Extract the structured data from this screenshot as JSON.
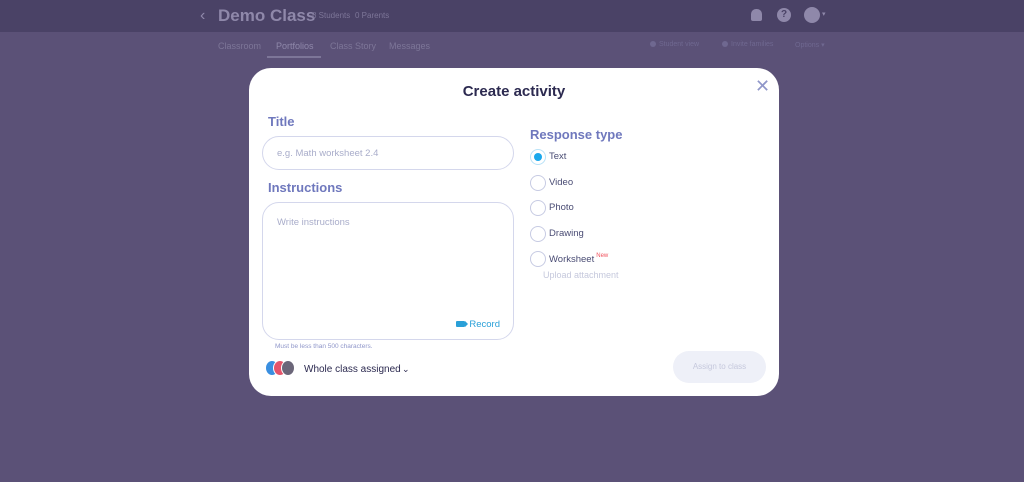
{
  "app": {
    "back_glyph": "‹",
    "class_name": "Demo Class",
    "student_count": "8 Students",
    "parent_count": "0 Parents",
    "help_glyph": "?",
    "caret_glyph": "▾"
  },
  "tabs": [
    {
      "label": "Classroom"
    },
    {
      "label": "Portfolios"
    },
    {
      "label": "Class Story"
    },
    {
      "label": "Messages"
    }
  ],
  "toolbar_right": {
    "student_view": "Student view",
    "invite_families": "Invite families",
    "options": "Options ▾"
  },
  "modal": {
    "title": "Create activity",
    "close_glyph": "✕",
    "title_label": "Title",
    "title_placeholder": "e.g. Math worksheet 2.4",
    "instructions_label": "Instructions",
    "instructions_placeholder": "Write instructions",
    "record_label": "Record",
    "char_hint": "Must be less than 500 characters.",
    "assignee_label": "Whole class assigned",
    "assignee_chevron": "⌄",
    "response_type_label": "Response type",
    "response_types": [
      {
        "label": "Text",
        "checked": true
      },
      {
        "label": "Video",
        "checked": false
      },
      {
        "label": "Photo",
        "checked": false
      },
      {
        "label": "Drawing",
        "checked": false
      },
      {
        "label": "Worksheet",
        "checked": false,
        "badge": "New"
      }
    ],
    "upload_label": "Upload attachment",
    "assign_button": "Assign to class"
  },
  "colors": {
    "overlay": "#5b5177",
    "accent": "#1aa8ec",
    "label": "#6f78bd",
    "badge": "#f0515c"
  }
}
